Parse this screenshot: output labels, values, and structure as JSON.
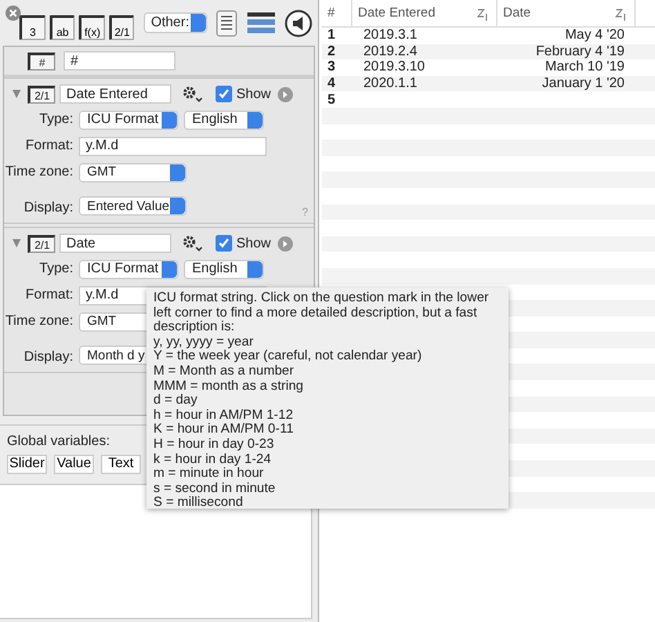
{
  "toolbar": {
    "type_buttons": [
      "3",
      "ab",
      "f(x)",
      "2/1"
    ],
    "other_select": "Other:"
  },
  "columns": [
    {
      "kind": "index",
      "icon_label": "#",
      "name": "#"
    },
    {
      "kind": "date",
      "icon_label": "2/1",
      "name": "Date Entered",
      "expanded": true,
      "show": true,
      "show_label": "Show",
      "type_label": "Type:",
      "type": "ICU Format",
      "language": "English",
      "format_label": "Format:",
      "format": "y.M.d",
      "time_zone_label": "Time zone:",
      "time_zone": "GMT",
      "display_label": "Display:",
      "display": "Entered Value",
      "help": "?"
    },
    {
      "kind": "date",
      "icon_label": "2/1",
      "name": "Date",
      "expanded": true,
      "show": true,
      "show_label": "Show",
      "type_label": "Type:",
      "type": "ICU Format",
      "language": "English",
      "format_label": "Format:",
      "format": "y.M.d",
      "time_zone_label": "Time zone:",
      "time_zone": "GMT",
      "display_label": "Display:",
      "display": "Month d y"
    }
  ],
  "global_variables": {
    "label": "Global variables:",
    "buttons": [
      "Slider",
      "Value",
      "Text"
    ]
  },
  "table": {
    "columns": [
      {
        "label": "#",
        "sortable": false
      },
      {
        "label": "Date Entered",
        "sortable": true
      },
      {
        "label": "Date",
        "sortable": true
      }
    ],
    "rows": [
      [
        "1",
        "2019.3.1",
        "May 4 '20"
      ],
      [
        "2",
        "2019.2.4",
        "February 4 '19"
      ],
      [
        "3",
        "2019.3.10",
        "March 10 '19"
      ],
      [
        "4",
        "2020.1.1",
        "January 1 '20"
      ],
      [
        "5",
        "",
        ""
      ]
    ]
  },
  "tooltip": {
    "intro": "ICU format string.  Click on the question mark in the lower left corner to find a more detailed description, but a fast description is:",
    "lines": [
      "y, yy, yyyy = year",
      "Y = the week year (careful, not calendar year)",
      "M = Month as a number",
      "MMM = month as a string",
      "d = day",
      "h = hour in AM/PM 1-12",
      "K = hour in AM/PM 0-11",
      "H = hour in day 0-23",
      "k = hour in day 1-24",
      "m = minute in hour",
      "s = second in minute",
      "S = millisecond"
    ]
  }
}
